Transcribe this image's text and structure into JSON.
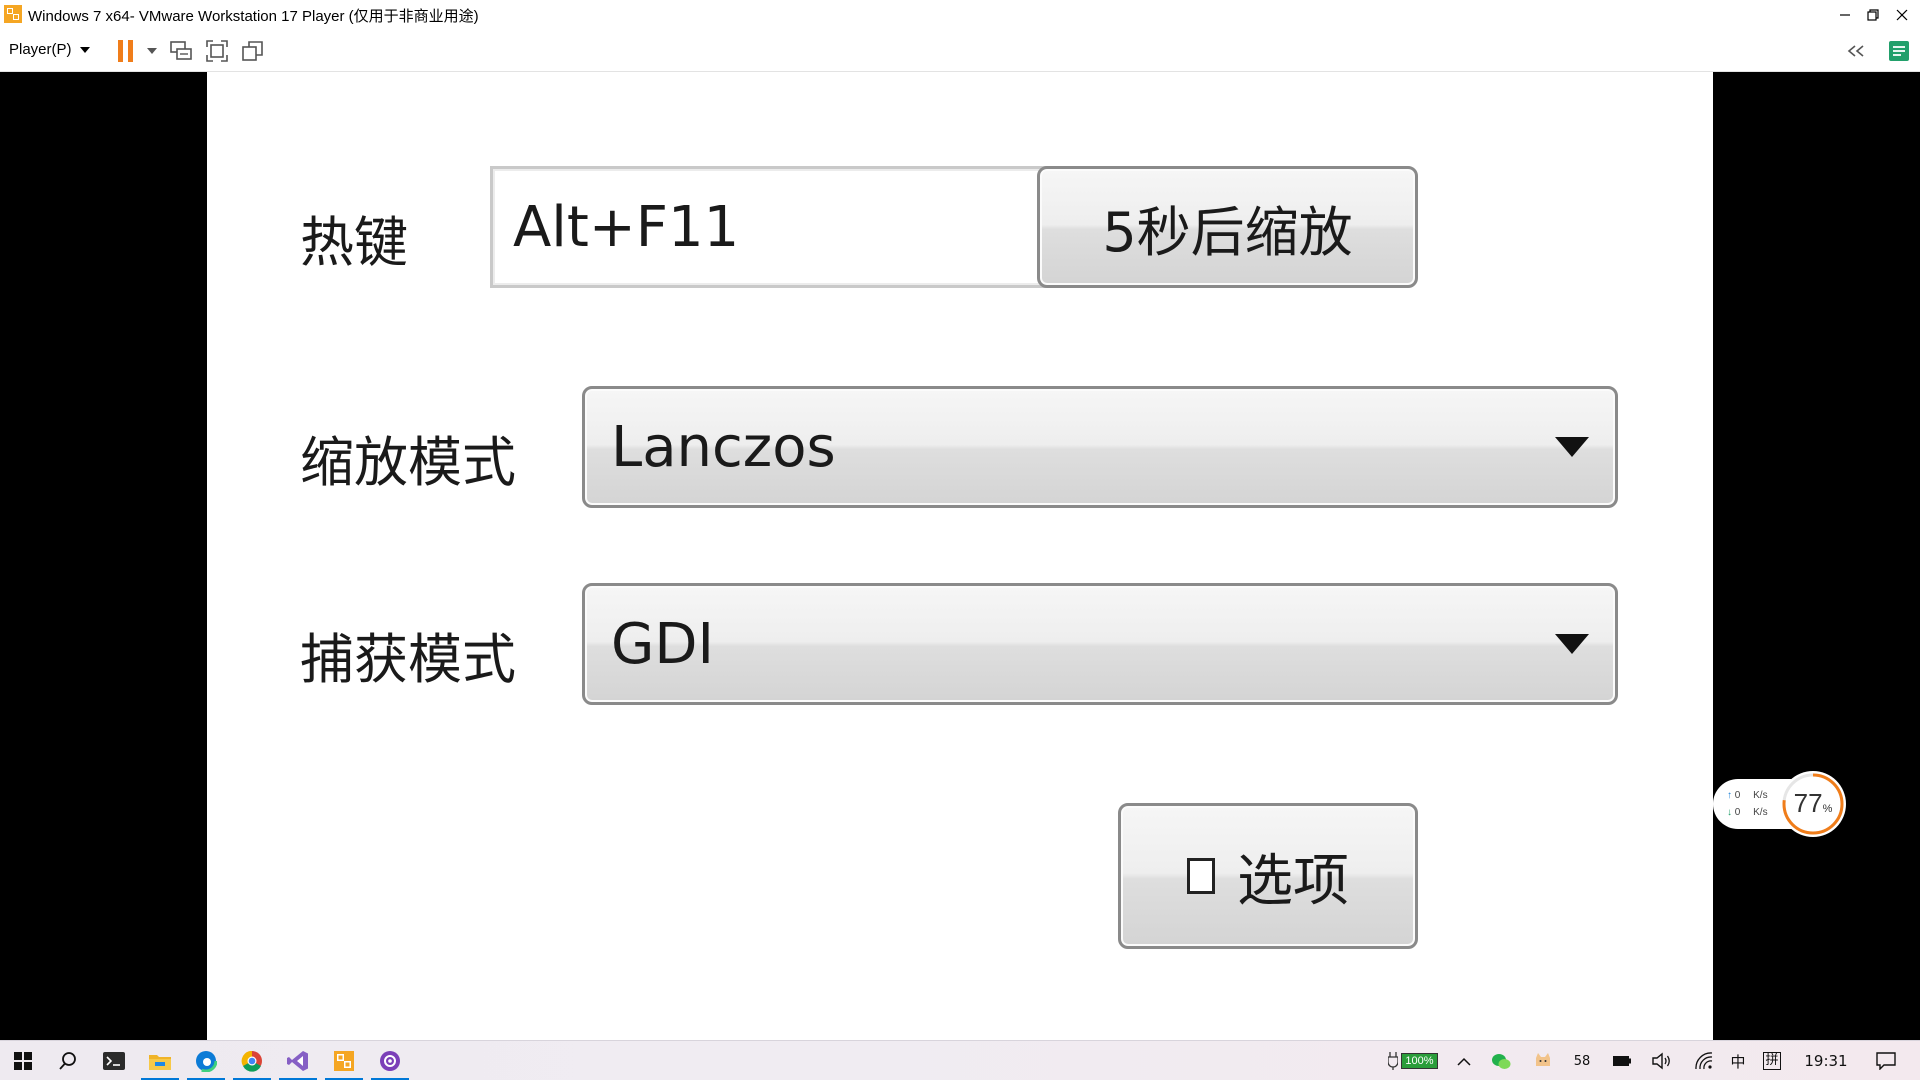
{
  "window": {
    "title": "Windows 7 x64- VMware Workstation 17 Player (仅用于非商业用途)"
  },
  "toolbar": {
    "player_menu": "Player(P)"
  },
  "dialog": {
    "hotkey_label": "热键",
    "hotkey_value": "Alt+F11",
    "zoom_button": "5秒后缩放",
    "scale_mode_label": "缩放模式",
    "scale_mode_value": "Lanczos",
    "capture_mode_label": "捕获模式",
    "capture_mode_value": "GDI",
    "options_button": "选项",
    "options_checked": false
  },
  "net_widget": {
    "up_value": "0",
    "up_unit": "K/s",
    "down_value": "0",
    "down_unit": "K/s",
    "percent": "77",
    "percent_sign": "%"
  },
  "taskbar": {
    "battery": "100%",
    "tray_number": "58",
    "ime_lang": "中",
    "ime_mode": "拼",
    "clock": "19:31"
  },
  "colors": {
    "accent_orange": "#f07d1a",
    "pin_green": "#22a06b",
    "taskbar_active": "#0078d7"
  }
}
